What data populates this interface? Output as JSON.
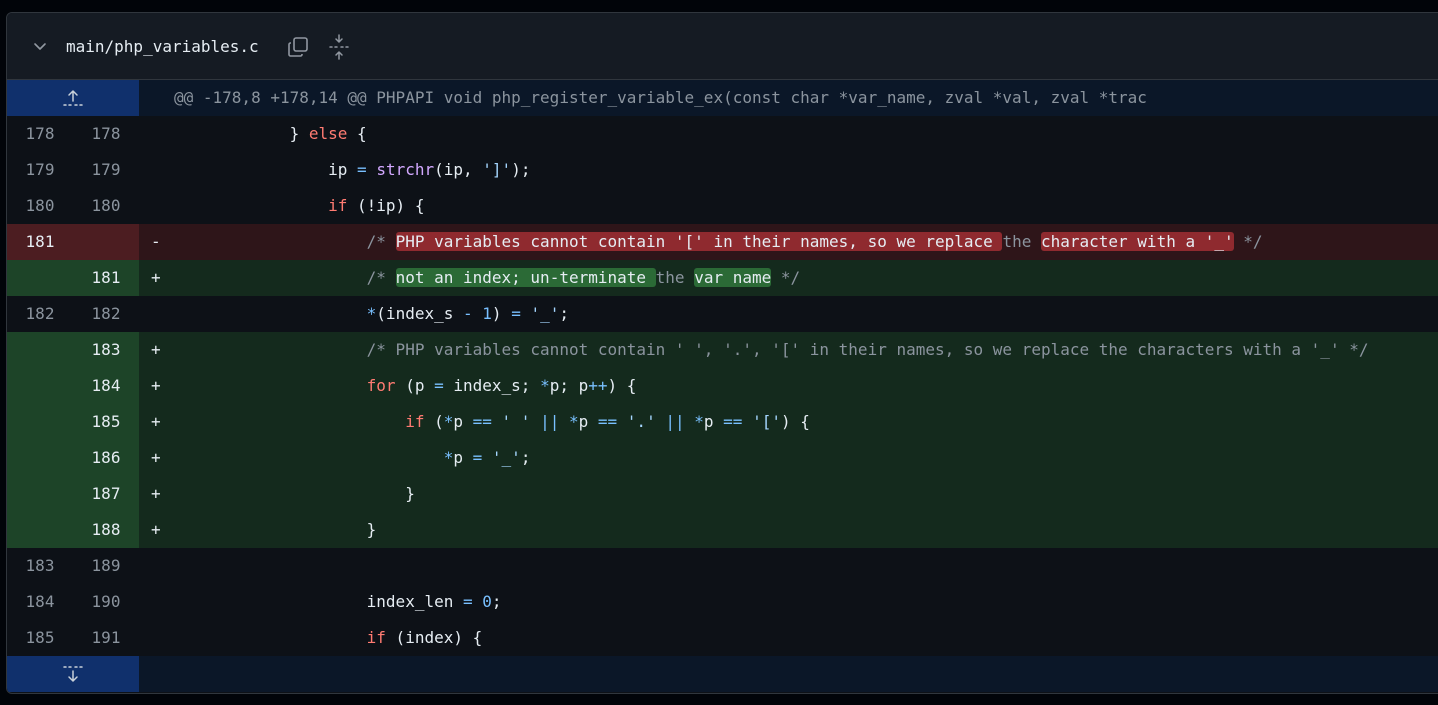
{
  "file": {
    "name": "main/php_variables.c",
    "collapse_icon": "chevron-down-icon",
    "copy_icon": "copy-icon",
    "expand_icon": "unfold-icon"
  },
  "hunk_header": "@@ -178,8 +178,14 @@ PHPAPI void php_register_variable_ex(const char *var_name, zval *val, zval *trac",
  "lines": [
    {
      "type": "ctx",
      "old": "178",
      "new": "178",
      "marker": "",
      "indent": "            ",
      "tokens": [
        {
          "c": "plain",
          "t": "} "
        },
        {
          "c": "kw",
          "t": "else"
        },
        {
          "c": "plain",
          "t": " {"
        }
      ]
    },
    {
      "type": "ctx",
      "old": "179",
      "new": "179",
      "marker": "",
      "indent": "                ",
      "tokens": [
        {
          "c": "plain",
          "t": "ip "
        },
        {
          "c": "op",
          "t": "="
        },
        {
          "c": "plain",
          "t": " "
        },
        {
          "c": "fn",
          "t": "strchr"
        },
        {
          "c": "plain",
          "t": "(ip, "
        },
        {
          "c": "str",
          "t": "']'"
        },
        {
          "c": "plain",
          "t": ");"
        }
      ]
    },
    {
      "type": "ctx",
      "old": "180",
      "new": "180",
      "marker": "",
      "indent": "                ",
      "tokens": [
        {
          "c": "kw",
          "t": "if"
        },
        {
          "c": "plain",
          "t": " (!ip) {"
        }
      ]
    },
    {
      "type": "del",
      "old": "181",
      "new": "",
      "marker": "-",
      "indent": "                    ",
      "tokens": [
        {
          "c": "cm",
          "t": "/* "
        },
        {
          "c": "cm-strong hl-del",
          "t": "PHP variables cannot contain '[' in their names, so we replace "
        },
        {
          "c": "cm",
          "t": "the "
        },
        {
          "c": "cm-strong hl-del",
          "t": "character with a '_'"
        },
        {
          "c": "cm",
          "t": " */"
        }
      ]
    },
    {
      "type": "add",
      "old": "",
      "new": "181",
      "marker": "+",
      "indent": "                    ",
      "tokens": [
        {
          "c": "cm",
          "t": "/* "
        },
        {
          "c": "cm-strong hl-add",
          "t": "not an index; un-terminate "
        },
        {
          "c": "cm",
          "t": "the "
        },
        {
          "c": "cm-strong hl-add",
          "t": "var name"
        },
        {
          "c": "cm",
          "t": " */"
        }
      ]
    },
    {
      "type": "ctx",
      "old": "182",
      "new": "182",
      "marker": "",
      "indent": "                    ",
      "tokens": [
        {
          "c": "op",
          "t": "*"
        },
        {
          "c": "plain",
          "t": "(index_s "
        },
        {
          "c": "op",
          "t": "-"
        },
        {
          "c": "plain",
          "t": " "
        },
        {
          "c": "num-lit",
          "t": "1"
        },
        {
          "c": "plain",
          "t": ") "
        },
        {
          "c": "op",
          "t": "="
        },
        {
          "c": "plain",
          "t": " "
        },
        {
          "c": "str",
          "t": "'_'"
        },
        {
          "c": "plain",
          "t": ";"
        }
      ]
    },
    {
      "type": "add",
      "old": "",
      "new": "183",
      "marker": "+",
      "indent": "                    ",
      "tokens": [
        {
          "c": "cm",
          "t": "/* PHP variables cannot contain ' ', '.', '[' in their names, so we replace the characters with a '_' */"
        }
      ]
    },
    {
      "type": "add",
      "old": "",
      "new": "184",
      "marker": "+",
      "indent": "                    ",
      "tokens": [
        {
          "c": "kw",
          "t": "for"
        },
        {
          "c": "plain",
          "t": " (p "
        },
        {
          "c": "op",
          "t": "="
        },
        {
          "c": "plain",
          "t": " index_s; "
        },
        {
          "c": "op",
          "t": "*"
        },
        {
          "c": "plain",
          "t": "p; p"
        },
        {
          "c": "op",
          "t": "++"
        },
        {
          "c": "plain",
          "t": ") {"
        }
      ]
    },
    {
      "type": "add",
      "old": "",
      "new": "185",
      "marker": "+",
      "indent": "                        ",
      "tokens": [
        {
          "c": "kw",
          "t": "if"
        },
        {
          "c": "plain",
          "t": " ("
        },
        {
          "c": "op",
          "t": "*"
        },
        {
          "c": "plain",
          "t": "p "
        },
        {
          "c": "op",
          "t": "=="
        },
        {
          "c": "plain",
          "t": " "
        },
        {
          "c": "str",
          "t": "' '"
        },
        {
          "c": "plain",
          "t": " "
        },
        {
          "c": "op",
          "t": "||"
        },
        {
          "c": "plain",
          "t": " "
        },
        {
          "c": "op",
          "t": "*"
        },
        {
          "c": "plain",
          "t": "p "
        },
        {
          "c": "op",
          "t": "=="
        },
        {
          "c": "plain",
          "t": " "
        },
        {
          "c": "str",
          "t": "'.'"
        },
        {
          "c": "plain",
          "t": " "
        },
        {
          "c": "op",
          "t": "||"
        },
        {
          "c": "plain",
          "t": " "
        },
        {
          "c": "op",
          "t": "*"
        },
        {
          "c": "plain",
          "t": "p "
        },
        {
          "c": "op",
          "t": "=="
        },
        {
          "c": "plain",
          "t": " "
        },
        {
          "c": "str",
          "t": "'['"
        },
        {
          "c": "plain",
          "t": ") {"
        }
      ]
    },
    {
      "type": "add",
      "old": "",
      "new": "186",
      "marker": "+",
      "indent": "                            ",
      "tokens": [
        {
          "c": "op",
          "t": "*"
        },
        {
          "c": "plain",
          "t": "p "
        },
        {
          "c": "op",
          "t": "="
        },
        {
          "c": "plain",
          "t": " "
        },
        {
          "c": "str",
          "t": "'_'"
        },
        {
          "c": "plain",
          "t": ";"
        }
      ]
    },
    {
      "type": "add",
      "old": "",
      "new": "187",
      "marker": "+",
      "indent": "                        ",
      "tokens": [
        {
          "c": "plain",
          "t": "}"
        }
      ]
    },
    {
      "type": "add",
      "old": "",
      "new": "188",
      "marker": "+",
      "indent": "                    ",
      "tokens": [
        {
          "c": "plain",
          "t": "}"
        }
      ]
    },
    {
      "type": "ctx",
      "old": "183",
      "new": "189",
      "marker": "",
      "indent": "",
      "tokens": []
    },
    {
      "type": "ctx",
      "old": "184",
      "new": "190",
      "marker": "",
      "indent": "                    ",
      "tokens": [
        {
          "c": "plain",
          "t": "index_len "
        },
        {
          "c": "op",
          "t": "="
        },
        {
          "c": "plain",
          "t": " "
        },
        {
          "c": "num-lit",
          "t": "0"
        },
        {
          "c": "plain",
          "t": ";"
        }
      ]
    },
    {
      "type": "ctx",
      "old": "185",
      "new": "191",
      "marker": "",
      "indent": "                    ",
      "tokens": [
        {
          "c": "kw",
          "t": "if"
        },
        {
          "c": "plain",
          "t": " (index) {"
        }
      ]
    }
  ],
  "expand_up_icon": "expand-up-icon",
  "expand_down_icon": "expand-down-icon"
}
